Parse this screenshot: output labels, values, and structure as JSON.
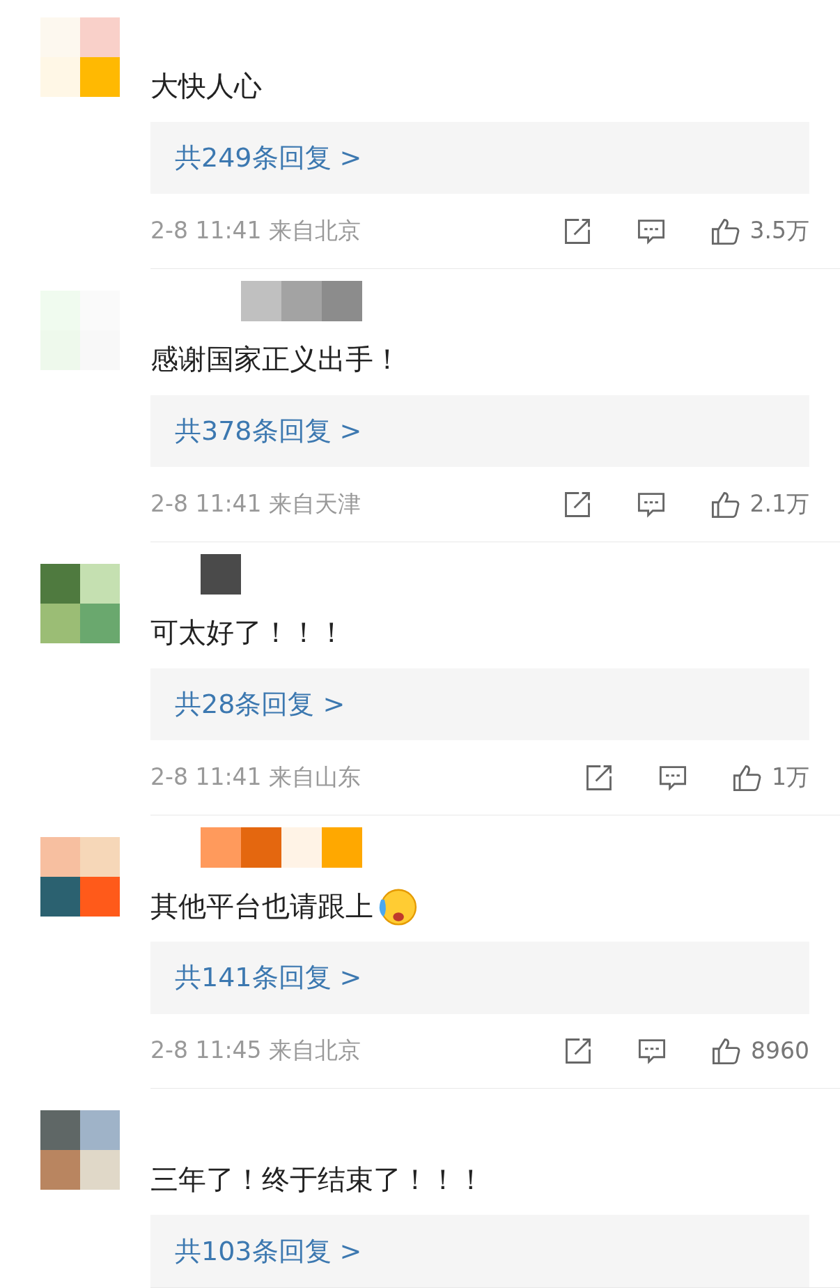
{
  "comments": [
    {
      "text": "大快人心",
      "replies": "共249条回复 >",
      "meta": "2-8 11:41 来自北京",
      "likes": "3.5万"
    },
    {
      "text": "感谢国家正义出手！",
      "replies": "共378条回复 >",
      "meta": "2-8 11:41 来自天津",
      "likes": "2.1万"
    },
    {
      "text": "可太好了！！！",
      "replies": "共28条回复 >",
      "meta": "2-8 11:41 来自山东",
      "likes": "1万"
    },
    {
      "text": "其他平台也请跟上",
      "emoji": true,
      "replies": "共141条回复 >",
      "meta": "2-8 11:45 来自北京",
      "likes": "8960"
    },
    {
      "text": "三年了！终于结束了！！！",
      "replies": "共103条回复 >"
    }
  ]
}
